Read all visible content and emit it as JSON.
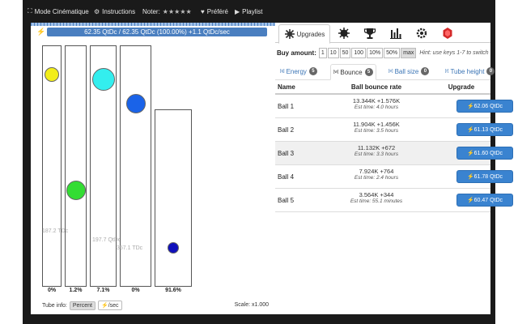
{
  "topbar": {
    "items": [
      {
        "icon": "expand-icon",
        "glyph": "⛶",
        "label": "Mode Cinématique"
      },
      {
        "icon": "gear-icon",
        "glyph": "⚙",
        "label": "Instructions"
      },
      {
        "label": "Noter:",
        "stars": "★★★★★"
      },
      {
        "icon": "heart-icon",
        "glyph": "♥",
        "label": "Préféré"
      },
      {
        "icon": "play-icon",
        "glyph": "▶",
        "label": "Playlist"
      }
    ]
  },
  "energy": {
    "text": "62.35 QtDc / 62.35 QtDc (100.00%) +1.1 QtDc/sec",
    "fill_percent": 100
  },
  "tubes": [
    {
      "label": "",
      "percent": "0%",
      "ball_color": "#f2ee1a",
      "ball_level": 0.88
    },
    {
      "label": "187.2 TDc",
      "percent": "1.2%",
      "ball_color": "#33dd33",
      "ball_level": 0.4
    },
    {
      "label": "197.7 QtDc",
      "percent": "7.1%",
      "ball_color": "#33eeee",
      "ball_level": 0.86
    },
    {
      "label": "",
      "percent": "0%",
      "ball_color": "#1a63e8",
      "ball_level": 0.76
    },
    {
      "label": "357.1 TDc",
      "percent": "91.6%",
      "ball_color": "#1010bb",
      "ball_level": 0.22
    }
  ],
  "tube_info": {
    "label": "Tube info:",
    "options": [
      "Percent",
      "⚡/sec"
    ],
    "active": "Percent"
  },
  "scale": "Scale: x1.000",
  "tabs": {
    "active_label": "Upgrades",
    "icons": [
      "burst-icon",
      "splat-icon",
      "trophy-icon",
      "bar-chart-icon",
      "settings-icon",
      "ruby-icon"
    ]
  },
  "buy": {
    "label": "Buy amount:",
    "amounts": [
      "1",
      "10",
      "50",
      "100",
      "10%",
      "50%",
      "max"
    ],
    "active": "max",
    "hint": "Hint: use keys 1-7 to switch"
  },
  "subtabs": [
    {
      "key": "[q]",
      "label": "Energy",
      "count": "5"
    },
    {
      "key": "[w]",
      "label": "Bounce",
      "count": "5"
    },
    {
      "key": "[e]",
      "label": "Ball size",
      "count": "0"
    },
    {
      "key": "[r]",
      "label": "Tube height",
      "count": "0"
    }
  ],
  "table": {
    "headers": {
      "name": "Name",
      "rate": "Ball bounce rate",
      "upgrade": "Upgrade"
    },
    "rows": [
      {
        "name": "Ball 1",
        "rate": "13.344K +1.576K",
        "est": "Est time: 4.0 hours",
        "cost": "⚡62.06 QtDc"
      },
      {
        "name": "Ball 2",
        "rate": "11.904K +1.456K",
        "est": "Est time: 3.5 hours",
        "cost": "⚡61.13 QtDc"
      },
      {
        "name": "Ball 3",
        "rate": "11.132K +672",
        "est": "Est time: 3.3 hours",
        "cost": "⚡61.60 QtDc"
      },
      {
        "name": "Ball 4",
        "rate": "7.924K +764",
        "est": "Est time: 2.4 hours",
        "cost": "⚡61.78 QtDc"
      },
      {
        "name": "Ball 5",
        "rate": "3.564K +344",
        "est": "Est time: 55.1 minutes",
        "cost": "⚡60.47 QtDc"
      }
    ]
  },
  "colors": {
    "accent": "#3a83d0",
    "energy_bar": "#4a7fc0"
  }
}
